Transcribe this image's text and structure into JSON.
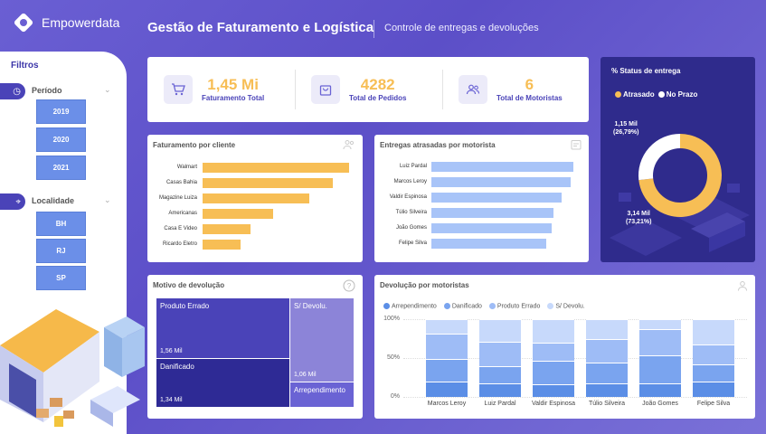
{
  "header": {
    "brand": "Empowerdata",
    "title": "Gestão de Faturamento e Logística",
    "subtitle": "Controle de entregas e devoluções"
  },
  "sidebar": {
    "title": "Filtros",
    "period_label": "Período",
    "years": [
      "2019",
      "2020",
      "2021"
    ],
    "location_label": "Localidade",
    "locations": [
      "BH",
      "RJ",
      "SP"
    ]
  },
  "kpis": [
    {
      "value": "1,45 Mi",
      "label": "Faturamento Total",
      "icon": "cart-icon"
    },
    {
      "value": "4282",
      "label": "Total de Pedidos",
      "icon": "bag-icon"
    },
    {
      "value": "6",
      "label": "Total de Motoristas",
      "icon": "users-icon"
    }
  ],
  "colors": {
    "accent": "#f7be55",
    "primary": "#4a43b8",
    "bar_blue": "#a8c4f8",
    "dark_panel": "#2f2b8c",
    "treemap_1": "#4a43b8",
    "treemap_2": "#2e2a95",
    "treemap_3": "#8c84d8",
    "treemap_4": "#6a63d4",
    "stack_1": "#5b8ee6",
    "stack_2": "#7aa4ef",
    "stack_3": "#9ebcf6",
    "stack_4": "#c7d9fb"
  },
  "faturamento": {
    "title": "Faturamento por cliente",
    "chart_data": {
      "type": "bar",
      "categories": [
        "Walmart",
        "Casas Bahia",
        "Magazine Luiza",
        "Americanas",
        "Casa E Video",
        "Ricardo Eletro"
      ],
      "values": [
        100,
        89,
        73,
        48,
        33,
        26
      ]
    }
  },
  "entregas": {
    "title": "Entregas atrasadas por motorista",
    "chart_data": {
      "type": "bar",
      "categories": [
        "Luiz Pardal",
        "Marcos Leroy",
        "Valdir Espinosa",
        "Túlio Silveira",
        "João Gomes",
        "Felipe Silva"
      ],
      "values": [
        100,
        98,
        92,
        86,
        85,
        81
      ]
    }
  },
  "status": {
    "title": "% Status de entrega",
    "legend": [
      "Atrasado",
      "No Prazo"
    ],
    "chart_data": {
      "type": "pie",
      "categories": [
        "Atrasado",
        "No Prazo"
      ],
      "values": [
        73.21,
        26.79
      ]
    },
    "label_no_prazo": [
      "1,15 Mil",
      "(26,79%)"
    ],
    "label_atrasado": [
      "3,14 Mil",
      "(73,21%)"
    ]
  },
  "devolucao": {
    "title": "Motivo de devolução",
    "cells": [
      {
        "name": "Produto Errado",
        "value": "1,56 Mil"
      },
      {
        "name": "Danificado",
        "value": "1,34 Mil"
      },
      {
        "name": "S/ Devolu.",
        "value": "1,06 Mil"
      },
      {
        "name": "Arrependimento",
        "value": ""
      }
    ]
  },
  "devolucao_motoristas": {
    "title": "Devolução por motoristas",
    "legend": [
      "Arrependimento",
      "Danificado",
      "Produto Errado",
      "S/ Devolu."
    ],
    "yticks": [
      "100%",
      "50%",
      "0%"
    ],
    "chart_data": {
      "type": "bar",
      "stacked": true,
      "categories": [
        "Marcos Leroy",
        "Luiz Pardal",
        "Valdir Espinosa",
        "Túlio Silveira",
        "João Gomes",
        "Felipe Silva"
      ],
      "ylim": [
        0,
        100
      ],
      "series": [
        {
          "name": "Arrependimento",
          "values": [
            20,
            17,
            16,
            18,
            17,
            20
          ]
        },
        {
          "name": "Danificado",
          "values": [
            29,
            23,
            30,
            26,
            36,
            22
          ]
        },
        {
          "name": "Produto Errado",
          "values": [
            32,
            31,
            24,
            30,
            34,
            25
          ]
        },
        {
          "name": "S/ Devolu.",
          "values": [
            19,
            29,
            30,
            26,
            13,
            33
          ]
        }
      ]
    }
  }
}
